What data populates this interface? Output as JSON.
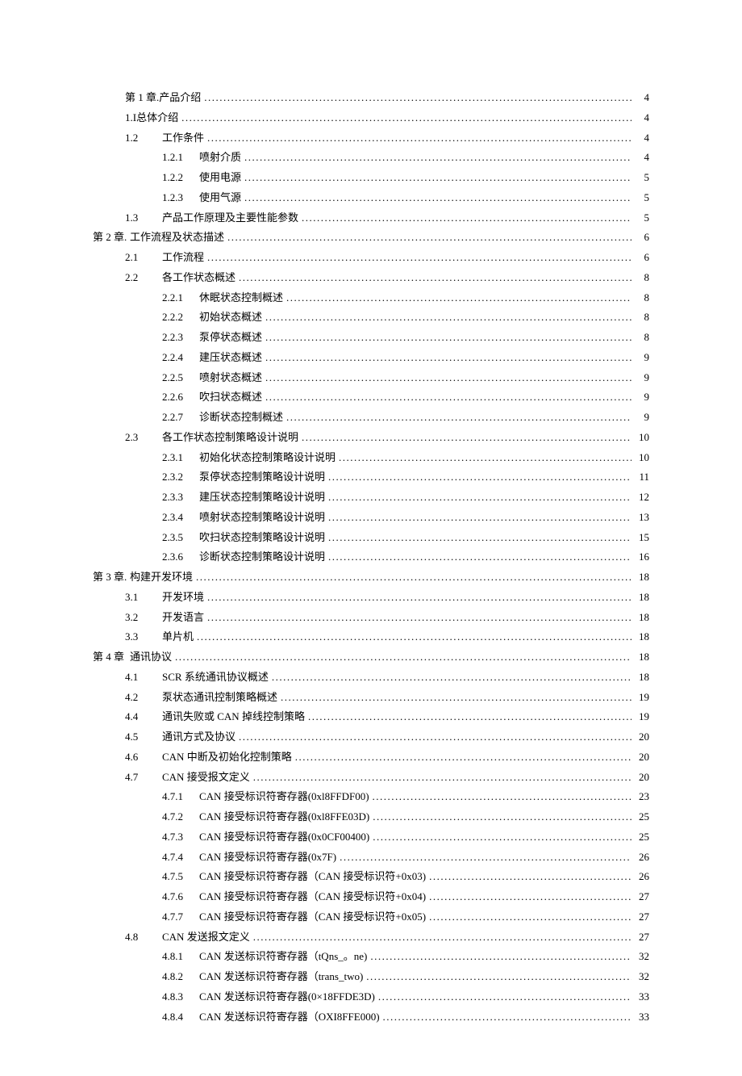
{
  "toc": [
    {
      "indent": "lvl1",
      "num": "第 1 章. ",
      "title": "产品介绍",
      "page": "4"
    },
    {
      "indent": "lvl1",
      "num": "1.I ",
      "title": "总体介绍",
      "page": "4"
    },
    {
      "indent": "lvl2",
      "num": "1.2",
      "title": "工作条件",
      "page": "4"
    },
    {
      "indent": "lvl3",
      "num": "1.2.1",
      "title": "喷射介质",
      "page": "4"
    },
    {
      "indent": "lvl3",
      "num": "1.2.2",
      "title": "使用电源",
      "page": "5"
    },
    {
      "indent": "lvl3",
      "num": "1.2.3",
      "title": "使用气源",
      "page": "5"
    },
    {
      "indent": "lvl2",
      "num": "1.3",
      "title": "产品工作原理及主要性能参数",
      "page": "5"
    },
    {
      "indent": "lvl1b",
      "num": "第 2 章. ",
      "title": "工作流程及状态描述",
      "page": "6"
    },
    {
      "indent": "lvl2",
      "num": "2.1",
      "title": "工作流程",
      "page": "6"
    },
    {
      "indent": "lvl2",
      "num": "2.2",
      "title": "各工作状态概述",
      "page": "8"
    },
    {
      "indent": "lvl3",
      "num": "2.2.1",
      "title": "休眠状态控制概述",
      "page": "8"
    },
    {
      "indent": "lvl3",
      "num": "2.2.2",
      "title": "初始状态概述",
      "page": "8"
    },
    {
      "indent": "lvl3",
      "num": "2.2.3",
      "title": "泵停状态概述",
      "page": "8"
    },
    {
      "indent": "lvl3",
      "num": "2.2.4",
      "title": "建压状态概述",
      "page": "9"
    },
    {
      "indent": "lvl3",
      "num": "2.2.5",
      "title": "喷射状态概述",
      "page": "9"
    },
    {
      "indent": "lvl3",
      "num": "2.2.6",
      "title": "吹扫状态概述",
      "page": "9"
    },
    {
      "indent": "lvl3",
      "num": "2.2.7",
      "title": "诊断状态控制概述",
      "page": "9"
    },
    {
      "indent": "lvl2",
      "num": "2.3",
      "title": "各工作状态控制策略设计说明",
      "page": "10"
    },
    {
      "indent": "lvl3",
      "num": "2.3.1",
      "title": "初始化状态控制策略设计说明",
      "page": "10"
    },
    {
      "indent": "lvl3",
      "num": "2.3.2",
      "title": "泵停状态控制策略设计说明",
      "page": "11"
    },
    {
      "indent": "lvl3",
      "num": "2.3.3",
      "title": "建压状态控制策略设计说明",
      "page": "12"
    },
    {
      "indent": "lvl3",
      "num": "2.3.4",
      "title": "喷射状态控制策略设计说明",
      "page": "13"
    },
    {
      "indent": "lvl3",
      "num": "2.3.5",
      "title": "吹扫状态控制策略设计说明",
      "page": "15"
    },
    {
      "indent": "lvl3",
      "num": "2.3.6",
      "title": "诊断状态控制策略设计说明",
      "page": "16"
    },
    {
      "indent": "lvl1b",
      "num": "第 3 章. ",
      "title": "构建开发环境",
      "page": "18"
    },
    {
      "indent": "lvl2",
      "num": "3.1",
      "title": "开发环境",
      "page": "18"
    },
    {
      "indent": "lvl2",
      "num": "3.2",
      "title": "开发语言",
      "page": "18"
    },
    {
      "indent": "lvl2",
      "num": "3.3",
      "title": "单片机",
      "page": "18"
    },
    {
      "indent": "lvl1b",
      "num": "第 4 章",
      "title": "通讯协议",
      "page": "18"
    },
    {
      "indent": "lvl2",
      "num": "4.1",
      "title": "SCR 系统通讯协议概述",
      "page": "18"
    },
    {
      "indent": "lvl2",
      "num": "4.2",
      "title": "泵状态通讯控制策略概述",
      "page": "19"
    },
    {
      "indent": "lvl2",
      "num": "4.4",
      "title": "通讯失败或 CAN 掉线控制策略",
      "page": "19"
    },
    {
      "indent": "lvl2",
      "num": "4.5",
      "title": "通讯方式及协议",
      "page": "20"
    },
    {
      "indent": "lvl2",
      "num": "4.6",
      "title": "CAN 中断及初始化控制策略",
      "page": "20"
    },
    {
      "indent": "lvl2",
      "num": "4.7",
      "title": "CAN 接受报文定义",
      "page": "20"
    },
    {
      "indent": "lvl3",
      "num": "4.7.1",
      "title": "CAN 接受标识符寄存器(0xl8FFDF00)",
      "page": "23"
    },
    {
      "indent": "lvl3",
      "num": "4.7.2",
      "title": "CAN 接受标识符寄存器(0xl8FFE03D)",
      "page": "25"
    },
    {
      "indent": "lvl3",
      "num": "4.7.3",
      "title": "CAN 接受标识符寄存器(0x0CF00400)",
      "page": "25"
    },
    {
      "indent": "lvl3",
      "num": "4.7.4",
      "title": "CAN 接受标识符寄存器(0x7F)",
      "page": "26"
    },
    {
      "indent": "lvl3",
      "num": "4.7.5",
      "title": "CAN 接受标识符寄存器（CAN 接受标识符+0x03)",
      "page": "26"
    },
    {
      "indent": "lvl3",
      "num": "4.7.6",
      "title": "CAN 接受标识符寄存器（CAN 接受标识符+0x04)",
      "page": "27"
    },
    {
      "indent": "lvl3",
      "num": "4.7.7",
      "title": "CAN 接受标识符寄存器（CAN 接受标识符+0x05)",
      "page": "27"
    },
    {
      "indent": "lvl2",
      "num": "4.8",
      "title": "CAN 发送报文定义",
      "page": "27"
    },
    {
      "indent": "lvl3",
      "num": "4.8.1",
      "title": "CAN 发送标识符寄存器（tQns_。ne)",
      "page": "32"
    },
    {
      "indent": "lvl3",
      "num": "4.8.2",
      "title": "CAN 发送标识符寄存器（trans_two)",
      "page": "32"
    },
    {
      "indent": "lvl3",
      "num": "4.8.3",
      "title": "CAN 发送标识符寄存器(0×18FFDE3D)",
      "page": "33"
    },
    {
      "indent": "lvl3",
      "num": "4.8.4",
      "title": "CAN 发送标识符寄存器（OXI8FFE000)",
      "page": "33"
    }
  ]
}
